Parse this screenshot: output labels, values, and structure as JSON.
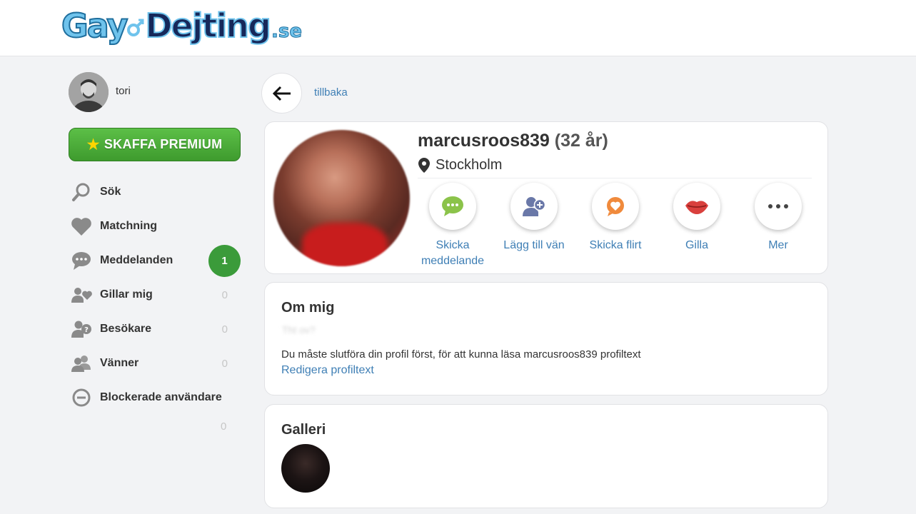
{
  "header": {
    "logo_part1": "Gay",
    "logo_part2": "Dejting",
    "logo_part3": ".se"
  },
  "user": {
    "name": "tori"
  },
  "premium": {
    "label": "SKAFFA PREMIUM",
    "star": "★"
  },
  "nav": {
    "items": [
      {
        "label": "Sök",
        "icon": "search-icon"
      },
      {
        "label": "Matchning",
        "icon": "heart-icon"
      },
      {
        "label": "Meddelanden",
        "icon": "chat-icon",
        "badge": "1"
      },
      {
        "label": "Gillar mig",
        "icon": "users-heart-icon",
        "count": "0"
      },
      {
        "label": "Besökare",
        "icon": "user-question-icon",
        "count": "0"
      },
      {
        "label": "Vänner",
        "icon": "users-icon",
        "count": "0"
      },
      {
        "label": "Blockerade användare",
        "icon": "block-icon"
      }
    ],
    "extra_count": "0"
  },
  "back": {
    "label": "tillbaka"
  },
  "profile": {
    "username": "marcusroos839",
    "age": "(32 år)",
    "location": "Stockholm",
    "actions": [
      {
        "label": "Skicka meddelande",
        "icon": "chat-bubble-icon"
      },
      {
        "label": "Lägg till vän",
        "icon": "add-friend-icon"
      },
      {
        "label": "Skicka flirt",
        "icon": "flirt-heart-icon"
      },
      {
        "label": "Gilla",
        "icon": "lips-icon"
      },
      {
        "label": "Mer",
        "icon": "more-dots-icon"
      }
    ]
  },
  "about": {
    "title": "Om mig",
    "blurred_text": "Tht ov?",
    "text": "Du måste slutföra din profil först, för att kunna läsa marcusroos839 profiltext",
    "edit_link": "Redigera profiltext"
  },
  "gallery": {
    "title": "Galleri"
  },
  "colors": {
    "accent_link": "#3f7fb5",
    "premium_green": "#4caf3e",
    "badge_green": "#3b9b3a"
  }
}
